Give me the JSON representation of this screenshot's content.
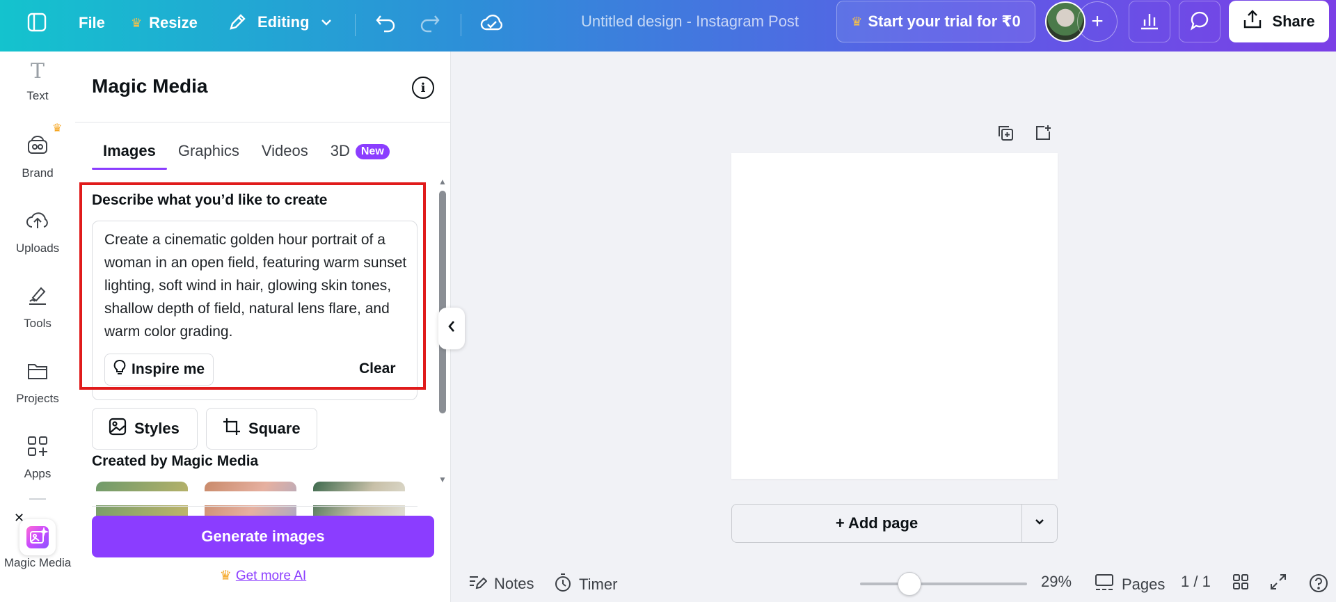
{
  "topbar": {
    "file_label": "File",
    "resize_label": "Resize",
    "editing_label": "Editing",
    "doc_title": "Untitled design - Instagram Post",
    "trial_label": "Start your trial for ₹0",
    "share_label": "Share",
    "accent_color": "#8b3dff"
  },
  "rail": {
    "items": [
      {
        "label": "Text",
        "icon": "text-icon"
      },
      {
        "label": "Brand",
        "icon": "brand-icon"
      },
      {
        "label": "Uploads",
        "icon": "upload-cloud-icon"
      },
      {
        "label": "Tools",
        "icon": "pen-tool-icon"
      },
      {
        "label": "Projects",
        "icon": "folder-icon"
      },
      {
        "label": "Apps",
        "icon": "apps-grid-icon"
      },
      {
        "label": "Magic Media",
        "icon": "magic-media-icon"
      }
    ]
  },
  "panel": {
    "title": "Magic Media",
    "tabs": [
      {
        "label": "Images",
        "active": true
      },
      {
        "label": "Graphics",
        "active": false
      },
      {
        "label": "Videos",
        "active": false
      },
      {
        "label": "3D",
        "active": false,
        "badge": "New"
      }
    ],
    "describe_label": "Describe what you’d like to create",
    "prompt_text": "Create a cinematic golden hour portrait of a woman in an open field, featuring warm sunset lighting, soft wind in hair, glowing skin tones, shallow depth of field, natural lens flare, and warm color grading.",
    "inspire_label": "Inspire me",
    "clear_label": "Clear",
    "styles_label": "Styles",
    "aspect_label": "Square",
    "created_label": "Created by Magic Media",
    "generate_label": "Generate images",
    "get_more_label": "Get more AI"
  },
  "canvas": {
    "add_page_label": "+ Add page"
  },
  "bottombar": {
    "notes_label": "Notes",
    "timer_label": "Timer",
    "zoom_label": "29%",
    "zoom_value": 0.29,
    "pages_label": "Pages",
    "page_count": "1 / 1"
  }
}
